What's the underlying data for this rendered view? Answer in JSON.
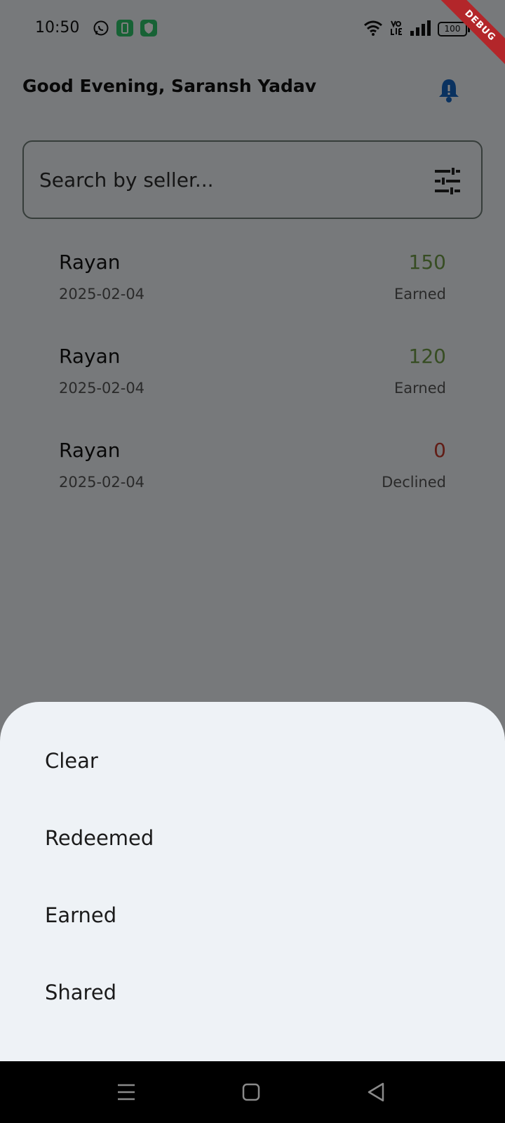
{
  "status_bar": {
    "time": "10:50",
    "battery": "100",
    "debug_label": "DEBUG"
  },
  "header": {
    "greeting": "Good Evening, Saransh Yadav"
  },
  "search": {
    "placeholder": "Search by seller..."
  },
  "transactions": [
    {
      "seller": "Rayan",
      "date": "2025-02-04",
      "amount": "150",
      "status": "Earned"
    },
    {
      "seller": "Rayan",
      "date": "2025-02-04",
      "amount": "120",
      "status": "Earned"
    },
    {
      "seller": "Rayan",
      "date": "2025-02-04",
      "amount": "0",
      "status": "Declined"
    }
  ],
  "filter_sheet": {
    "options": [
      "Clear",
      "Redeemed",
      "Earned",
      "Shared"
    ]
  },
  "colors": {
    "earned": "#6f9a46",
    "declined": "#c23a2c",
    "bell": "#1565c0"
  }
}
